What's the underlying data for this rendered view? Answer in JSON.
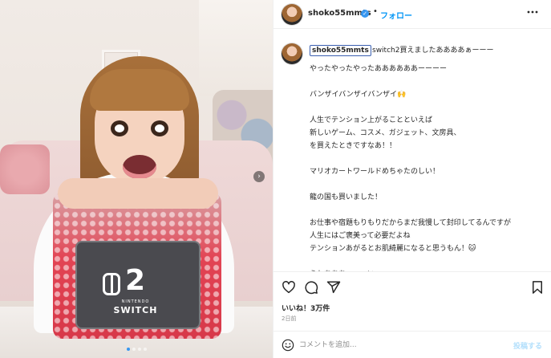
{
  "post": {
    "username": "shoko55mmts",
    "follow_label": "フォロー",
    "separator": "•",
    "more_icon": "more-horizontal-icon",
    "verified_glyph": "✓",
    "photo": {
      "console_number": "2",
      "console_brand": "NINTENDO",
      "console_name": "SWITCH",
      "carousel_next_glyph": "›",
      "carousel_dot_count": 4,
      "active_dot_index": 0
    }
  },
  "caption": {
    "username": "shoko55mmts",
    "first_line": "switch2買えましたああああぁーーー",
    "body": "やったやったやったああああああーーーー\n\nバンザイバンザイバンザイ🙌\n\n人生でテンション上がることといえば\n新しいゲーム、コスメ、ガジェット、文房具、\nを買えたときですなあ！！\n\nマリオカートワールドめちゃたのしい！\n\n龍の国も買いました！\n\nお仕事や宿題もりもりだからまだ我慢して封印してるんですが\n人生にはご褒美って必要だよね\nテンションあがるとお肌綺麗になると思うもん！🐱\n\nうわあああーーーい\nゲームできる時間は貴重だから味わって噛み締めます\n\nたのしいいいいいいい"
  },
  "actions": {
    "icons": [
      "heart-icon",
      "comment-icon",
      "share-icon",
      "save-icon"
    ]
  },
  "likes_text": "いいね！3万件",
  "time_text": "2日前",
  "comment": {
    "placeholder": "コメントを追加...",
    "post_label": "投稿する",
    "emoji_icon": "emoji-icon"
  },
  "colors": {
    "accent_blue": "#0095f6",
    "verified_blue": "#3897f0",
    "post_disabled": "#b2dffc",
    "text_primary": "#262626",
    "text_secondary": "#8e8e8e",
    "box_red": "#e24454"
  }
}
